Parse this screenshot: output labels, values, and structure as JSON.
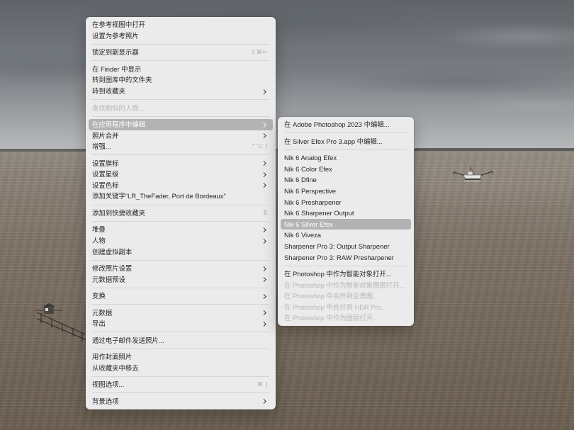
{
  "colors": {
    "menu_background": "#ebebeb",
    "highlight": "#b3b3b3",
    "text": "#262626",
    "disabled_text": "#b5b5b5",
    "shortcut_text": "#a8a8a8",
    "separator": "#d4d4d4"
  },
  "context_menu": {
    "items": [
      {
        "label": "在参考视图中打开"
      },
      {
        "label": "设置为参考照片"
      },
      {
        "label": "锁定到副显示器",
        "shortcut": "⇧⌘↩"
      },
      {
        "label": "在 Finder 中显示"
      },
      {
        "label": "转到图库中的文件夹"
      },
      {
        "label": "转到收藏夹",
        "submenu_icon": "chevron-right"
      },
      {
        "label": "查找相似的人脸...",
        "disabled": true
      },
      {
        "label": "在应用程序中编辑",
        "submenu_icon": "chevron-right",
        "highlighted": true
      },
      {
        "label": "照片合并",
        "submenu_icon": "chevron-right"
      },
      {
        "label": "增强...",
        "shortcut": "⌃⌥ I"
      },
      {
        "label": "设置旗标",
        "submenu_icon": "chevron-right"
      },
      {
        "label": "设置星级",
        "submenu_icon": "chevron-right"
      },
      {
        "label": "设置色标",
        "submenu_icon": "chevron-right"
      },
      {
        "label": "添加关键字“LR_TheFader, Port de Bordeaux”"
      },
      {
        "label": "添加到快捷收藏夹",
        "shortcut": "B"
      },
      {
        "label": "堆叠",
        "submenu_icon": "chevron-right"
      },
      {
        "label": "人物",
        "submenu_icon": "chevron-right"
      },
      {
        "label": "创建虚拟副本"
      },
      {
        "label": "修改照片设置",
        "submenu_icon": "chevron-right"
      },
      {
        "label": "元数据预设",
        "submenu_icon": "chevron-right"
      },
      {
        "label": "变换",
        "submenu_icon": "chevron-right"
      },
      {
        "label": "元数据",
        "submenu_icon": "chevron-right"
      },
      {
        "label": "导出",
        "submenu_icon": "chevron-right"
      },
      {
        "label": "通过电子邮件发送照片..."
      },
      {
        "label": "用作封面照片"
      },
      {
        "label": "从收藏夹中移去"
      },
      {
        "label": "视图选项...",
        "shortcut": "⌘ J"
      },
      {
        "label": "背景选项",
        "submenu_icon": "chevron-right"
      }
    ]
  },
  "edit_in_submenu": {
    "items": [
      {
        "label": "在 Adobe Photoshop 2023 中编辑..."
      },
      {
        "label": "在 Silver Efex Pro 3.app 中编辑..."
      },
      {
        "label": "Nik 6 Analog Efex"
      },
      {
        "label": "Nik 6 Color Efex"
      },
      {
        "label": "Nik 6 Dfine"
      },
      {
        "label": "Nik 6 Perspective"
      },
      {
        "label": "Nik 6 Presharpener"
      },
      {
        "label": "Nik 6 Sharpener Output"
      },
      {
        "label": "Nik 6 Silver Efex",
        "highlighted": true
      },
      {
        "label": "Nik 6 Viveza"
      },
      {
        "label": "Sharpener Pro 3: Output Sharpener"
      },
      {
        "label": "Sharpener Pro 3: RAW Presharpener"
      },
      {
        "label": "在 Photoshop 中作为智能对象打开..."
      },
      {
        "label": "在 Photoshop 中作为智能对象图层打开...",
        "disabled": true
      },
      {
        "label": "在 Photoshop 中合并到全景图...",
        "disabled": true
      },
      {
        "label": "在 Photoshop 中合并到 HDR Pro...",
        "disabled": true
      },
      {
        "label": "在 Photoshop 中作为图层打开...",
        "disabled": true
      }
    ]
  }
}
